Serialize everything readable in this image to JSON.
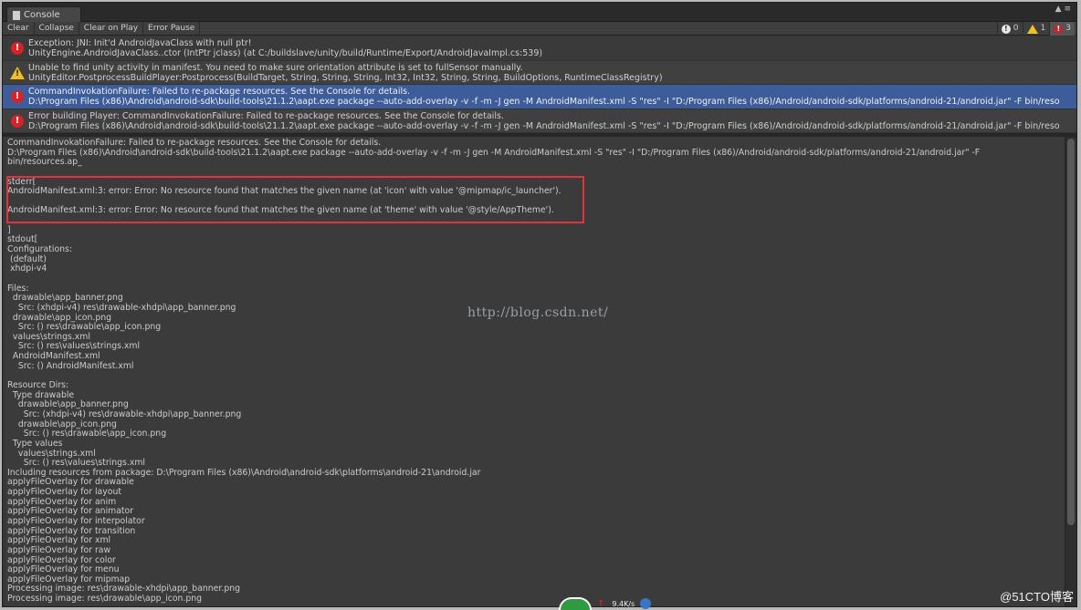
{
  "window": {
    "tab_title": "Console",
    "controls_glyph": "▲ ≡"
  },
  "toolbar": {
    "clear": "Clear",
    "collapse": "Collapse",
    "clear_on_play": "Clear on Play",
    "error_pause": "Error Pause",
    "count_info": "0",
    "count_warning": "1",
    "count_error": "3"
  },
  "log_entries": [
    {
      "type": "error",
      "line1": "Exception: JNI: Init'd AndroidJavaClass with null ptr!",
      "line2": "UnityEngine.AndroidJavaClass..ctor (IntPtr jclass) (at C:/buildslave/unity/build/Runtime/Export/AndroidJavaImpl.cs:539)"
    },
    {
      "type": "warning",
      "line1": "Unable to find unity activity in manifest. You need to make sure orientation attribute is set to fullSensor manually.",
      "line2": "UnityEditor.PostprocessBuildPlayer:Postprocess(BuildTarget, String, String, String, Int32, Int32, String, String, BuildOptions, RuntimeClassRegistry)"
    },
    {
      "type": "error",
      "selected": true,
      "line1": "CommandInvokationFailure: Failed to re-package resources. See the Console for details.",
      "line2": "D:\\Program Files (x86)\\Android\\android-sdk\\build-tools\\21.1.2\\aapt.exe package --auto-add-overlay -v -f -m -J gen -M AndroidManifest.xml -S \"res\" -I \"D:/Program Files (x86)/Android/android-sdk/platforms/android-21/android.jar\" -F bin/reso"
    },
    {
      "type": "error",
      "line1": "Error building Player: CommandInvokationFailure: Failed to re-package resources. See the Console for details.",
      "line2": "D:\\Program Files (x86)\\Android\\android-sdk\\build-tools\\21.1.2\\aapt.exe package --auto-add-overlay -v -f -m -J gen -M AndroidManifest.xml -S \"res\" -I \"D:/Program Files (x86)/Android/android-sdk/platforms/android-21/android.jar\" -F bin/reso"
    }
  ],
  "detail_lines": [
    "CommandInvokationFailure: Failed to re-package resources. See the Console for details.",
    "D:\\Program Files (x86)\\Android\\android-sdk\\build-tools\\21.1.2\\aapt.exe package --auto-add-overlay -v -f -m -J gen -M AndroidManifest.xml -S \"res\" -I \"D:/Program Files (x86)/Android/android-sdk/platforms/android-21/android.jar\" -F",
    "bin/resources.ap_",
    "",
    "stderr[",
    "AndroidManifest.xml:3: error: Error: No resource found that matches the given name (at 'icon' with value '@mipmap/ic_launcher').",
    "",
    "AndroidManifest.xml:3: error: Error: No resource found that matches the given name (at 'theme' with value '@style/AppTheme').",
    "",
    "]",
    "stdout[",
    "Configurations:",
    " (default)",
    " xhdpi-v4",
    "",
    "Files:",
    "  drawable\\app_banner.png",
    "    Src: (xhdpi-v4) res\\drawable-xhdpi\\app_banner.png",
    "  drawable\\app_icon.png",
    "    Src: () res\\drawable\\app_icon.png",
    "  values\\strings.xml",
    "    Src: () res\\values\\strings.xml",
    "  AndroidManifest.xml",
    "    Src: () AndroidManifest.xml",
    "",
    "Resource Dirs:",
    "  Type drawable",
    "    drawable\\app_banner.png",
    "      Src: (xhdpi-v4) res\\drawable-xhdpi\\app_banner.png",
    "    drawable\\app_icon.png",
    "      Src: () res\\drawable\\app_icon.png",
    "  Type values",
    "    values\\strings.xml",
    "      Src: () res\\values\\strings.xml",
    "Including resources from package: D:\\Program Files (x86)\\Android\\android-sdk\\platforms\\android-21\\android.jar",
    "applyFileOverlay for drawable",
    "applyFileOverlay for layout",
    "applyFileOverlay for anim",
    "applyFileOverlay for animator",
    "applyFileOverlay for interpolator",
    "applyFileOverlay for transition",
    "applyFileOverlay for xml",
    "applyFileOverlay for raw",
    "applyFileOverlay for color",
    "applyFileOverlay for menu",
    "applyFileOverlay for mipmap",
    "Processing image: res\\drawable-xhdpi\\app_banner.png",
    "Processing image: res\\drawable\\app_icon.png"
  ],
  "overlay": {
    "watermark": "http://blog.csdn.net/",
    "brand": "@51CTO博客",
    "net_speed": "9.4K/s",
    "net_arrow": "↑"
  },
  "icons": {
    "error": "error-icon",
    "warning": "warning-icon",
    "info": "info-icon"
  },
  "colors": {
    "error": "#d3242b",
    "warning": "#f2c01e",
    "selected_row": "#3d5d9a",
    "highlight_box": "#e0343d"
  }
}
